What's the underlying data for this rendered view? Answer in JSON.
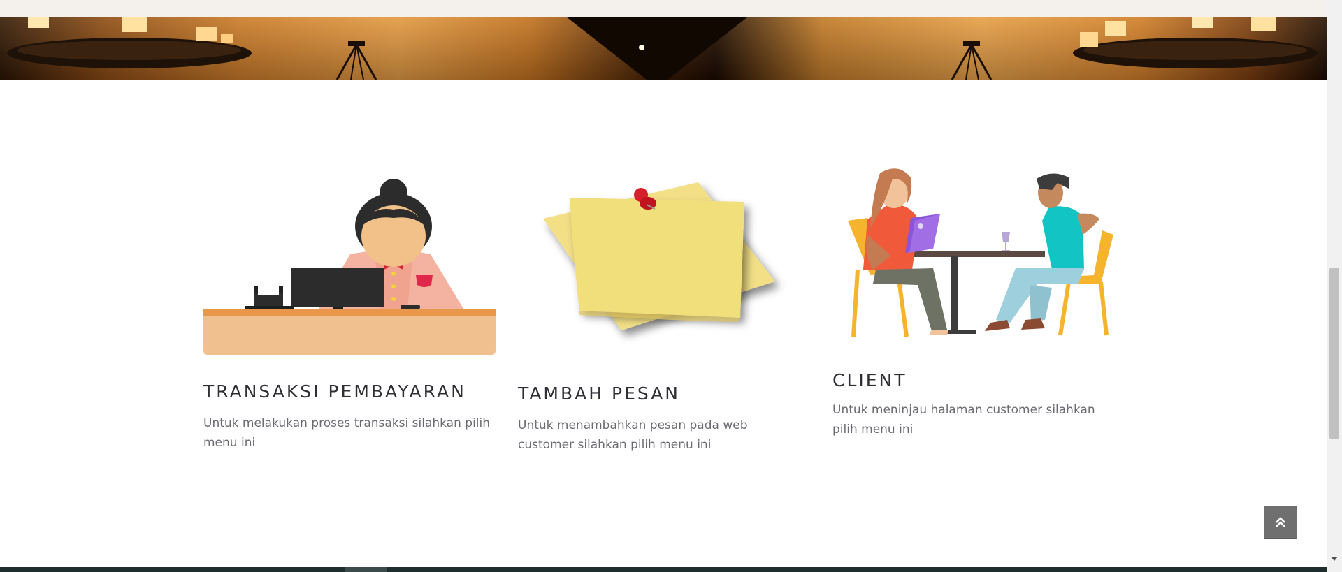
{
  "hero": {
    "image": "restaurant-ceiling-chandeliers"
  },
  "features": [
    {
      "title": "TRANSAKSI PEMBAYARAN",
      "description": "Untuk melakukan proses transaksi silahkan pilih menu ini",
      "illustration": "cashier-illustration"
    },
    {
      "title": "TAMBAH PESAN",
      "description": "Untuk menambahkan pesan pada web customer silahkan pilih menu ini",
      "illustration": "sticky-note-illustration"
    },
    {
      "title": "CLIENT",
      "description": "Untuk meninjau halaman customer silahkan pilih menu ini",
      "illustration": "dining-clients-illustration"
    }
  ],
  "back_to_top": {
    "icon": "double-chevron-up-icon"
  },
  "colors": {
    "title": "#2f2f36",
    "text": "#6b6b73",
    "button": "#6f6f6f",
    "footer": "#1e2e2e"
  }
}
